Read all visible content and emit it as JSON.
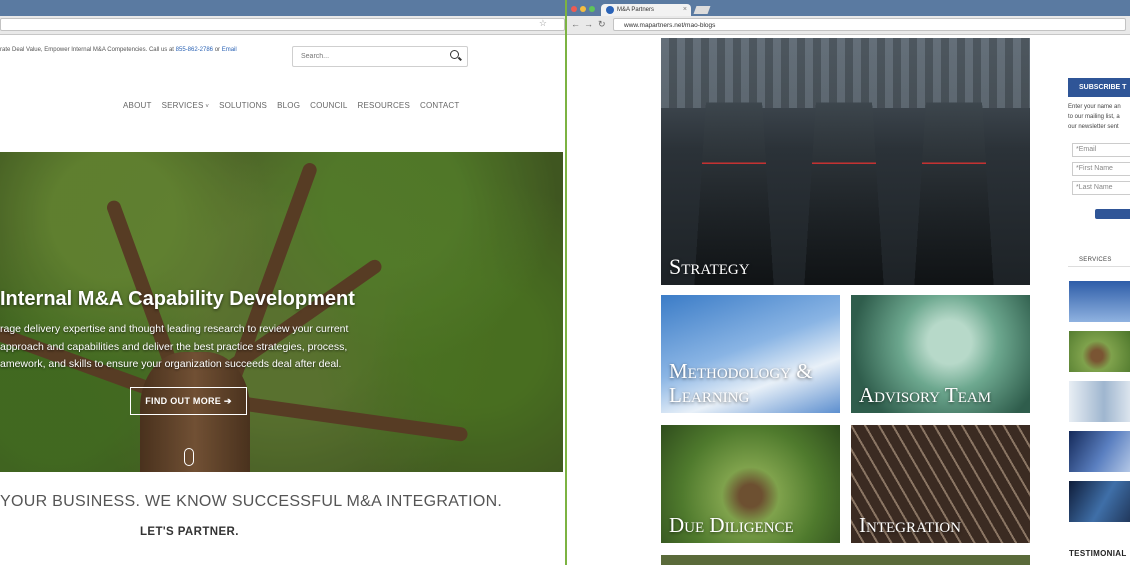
{
  "left_window": {
    "topline_text": "rate Deal Value, Empower Internal M&A Competencies. Call us at",
    "phone": "855-862-2786",
    "or_text": "or",
    "email_link": "Email",
    "search_placeholder": "Search...",
    "nav": [
      "ABOUT",
      "SERVICES",
      "SOLUTIONS",
      "BLOG",
      "COUNCIL",
      "RESOURCES",
      "CONTACT"
    ],
    "hero_title": "Internal M&A Capability Development",
    "hero_body_1": "rage delivery expertise and thought leading research to review your current",
    "hero_body_2": "approach and capabilities and deliver the best practice strategies, process,",
    "hero_body_3": "amework, and skills to ensure your organization succeeds deal after deal.",
    "cta_label": "FIND OUT MORE",
    "cta_arrow": "➔",
    "tagline": "YOUR BUSINESS. WE KNOW SUCCESSFUL M&A INTEGRATION.",
    "partner": "LET'S PARTNER."
  },
  "right_window": {
    "tab_title": "M&A Partners",
    "tab_close": "×",
    "url": "www.mapartners.net/mao-blogs",
    "nav_back": "←",
    "nav_forward": "→",
    "nav_reload": "↻",
    "tiles": [
      "Strategy",
      "Methodology &",
      "Learning",
      "Advisory Team",
      "Due Diligence",
      "Integration"
    ],
    "subscribe_label": "SUBSCRIBE T",
    "subscribe_text_1": "Enter your name an",
    "subscribe_text_2": "to our mailing list, a",
    "subscribe_text_3": "our newsletter sent",
    "field_email": "*Email",
    "field_first": "*First Name",
    "field_last": "*Last Name",
    "services_heading": "SERVICES",
    "testimonials": "TESTIMONIAL"
  },
  "colors": {
    "chrome_blue": "#5a7aa1",
    "link_blue": "#2b63b5",
    "subscribe_blue": "#2f5597",
    "divider_green": "#7cb342"
  }
}
